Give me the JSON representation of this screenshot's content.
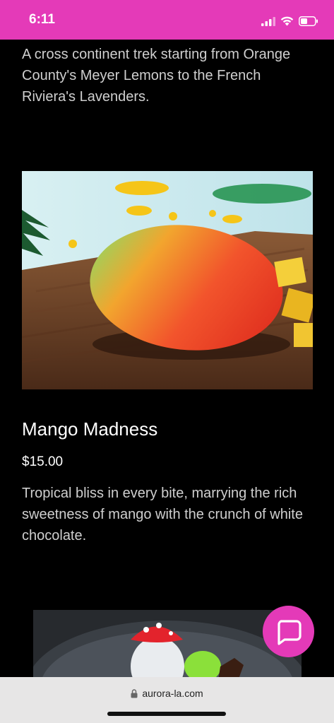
{
  "status_bar": {
    "time": "6:11",
    "background": "#e43ab8"
  },
  "intro": {
    "description": "A cross continent trek  starting   from Orange County's Meyer Lemons to the French Riviera's Lavenders."
  },
  "product": {
    "image_icon": "mango-dessert-image",
    "title": "Mango Madness",
    "price": "$15.00",
    "description": "Tropical bliss in every bite, marrying the rich sweetness of mango with the crunch of white chocolate."
  },
  "next_product": {
    "image_icon": "mushroom-dessert-image"
  },
  "chat": {
    "icon": "chat-bubble-icon",
    "color": "#e43ab8"
  },
  "browser": {
    "url": "aurora-la.com",
    "lock_icon": "lock-icon"
  }
}
